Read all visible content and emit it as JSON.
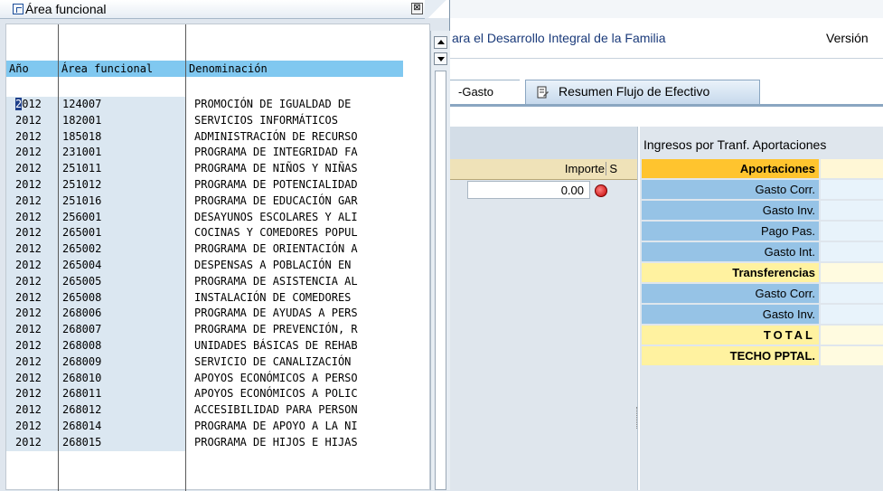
{
  "popup": {
    "title": "Área funcional",
    "close_glyph": "⊠",
    "columns": [
      "Año",
      "Área funcional",
      "Denominación"
    ],
    "rows": [
      {
        "year": "2012",
        "area": "124007",
        "name": "PROMOCIÓN DE IGUALDAD DE"
      },
      {
        "year": "2012",
        "area": "182001",
        "name": "SERVICIOS INFORMÁTICOS"
      },
      {
        "year": "2012",
        "area": "185018",
        "name": "ADMINISTRACIÓN DE RECURSO"
      },
      {
        "year": "2012",
        "area": "231001",
        "name": "PROGRAMA DE INTEGRIDAD FA"
      },
      {
        "year": "2012",
        "area": "251011",
        "name": "PROGRAMA DE NIÑOS Y NIÑAS"
      },
      {
        "year": "2012",
        "area": "251012",
        "name": "PROGRAMA DE POTENCIALIDAD"
      },
      {
        "year": "2012",
        "area": "251016",
        "name": "PROGRAMA DE EDUCACIÓN GAR"
      },
      {
        "year": "2012",
        "area": "256001",
        "name": "DESAYUNOS ESCOLARES Y ALI"
      },
      {
        "year": "2012",
        "area": "265001",
        "name": "COCINAS Y COMEDORES POPUL"
      },
      {
        "year": "2012",
        "area": "265002",
        "name": "PROGRAMA DE ORIENTACIÓN A"
      },
      {
        "year": "2012",
        "area": "265004",
        "name": "DESPENSAS A POBLACIÓN EN"
      },
      {
        "year": "2012",
        "area": "265005",
        "name": "PROGRAMA DE ASISTENCIA AL"
      },
      {
        "year": "2012",
        "area": "265008",
        "name": "INSTALACIÓN DE COMEDORES"
      },
      {
        "year": "2012",
        "area": "268006",
        "name": "PROGRAMA DE AYUDAS A PERS"
      },
      {
        "year": "2012",
        "area": "268007",
        "name": "PROGRAMA DE PREVENCIÓN, R"
      },
      {
        "year": "2012",
        "area": "268008",
        "name": "UNIDADES BÁSICAS DE REHAB"
      },
      {
        "year": "2012",
        "area": "268009",
        "name": "SERVICIO DE CANALIZACIÓN"
      },
      {
        "year": "2012",
        "area": "268010",
        "name": "APOYOS ECONÓMICOS A PERSO"
      },
      {
        "year": "2012",
        "area": "268011",
        "name": "APOYOS ECONÓMICOS A POLIC"
      },
      {
        "year": "2012",
        "area": "268012",
        "name": "ACCESIBILIDAD PARA PERSON"
      },
      {
        "year": "2012",
        "area": "268014",
        "name": "PROGRAMA DE APOYO A LA NI"
      },
      {
        "year": "2012",
        "area": "268015",
        "name": "PROGRAMA DE HIJOS E HIJAS"
      }
    ]
  },
  "app": {
    "header_title": "ara el Desarrollo Integral de la Familia",
    "version_label": "Versión",
    "tabs": [
      "-Gasto",
      "Resumen Flujo de Efectivo"
    ],
    "left": {
      "col_importe": "Importe",
      "col_s": "S",
      "amount": "0.00"
    },
    "right": {
      "title": "Ingresos por Tranf. Aportaciones",
      "rows": [
        {
          "label": "Aportaciones",
          "style": "orange"
        },
        {
          "label": "Gasto Corr.",
          "style": "blue"
        },
        {
          "label": "Gasto Inv.",
          "style": "blue"
        },
        {
          "label": "Pago Pas.",
          "style": "blue"
        },
        {
          "label": "Gasto Int.",
          "style": "blue"
        },
        {
          "label": "Transferencias",
          "style": "yellow"
        },
        {
          "label": "Gasto Corr.",
          "style": "blue"
        },
        {
          "label": "Gasto Inv.",
          "style": "blue"
        },
        {
          "label": "TOTAL",
          "style": "yellow total"
        },
        {
          "label": "TECHO PPTAL.",
          "style": "yellow"
        }
      ]
    }
  }
}
